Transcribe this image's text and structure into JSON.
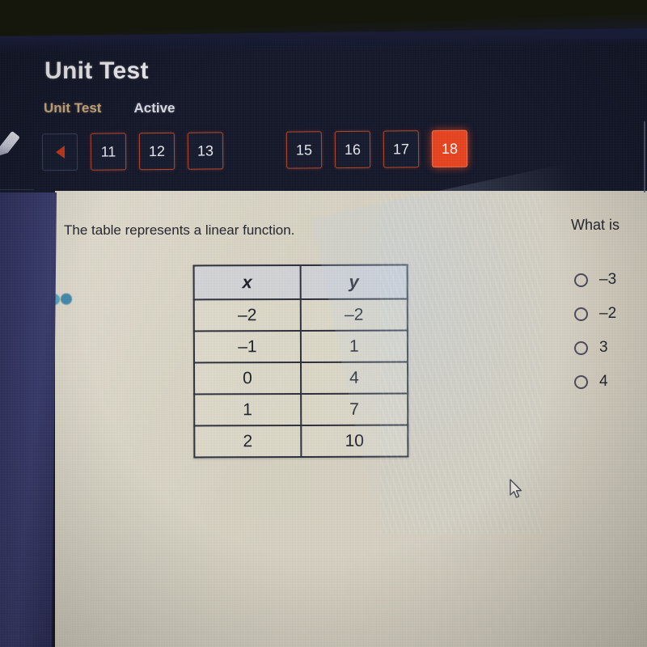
{
  "header": {
    "title": "Unit Test",
    "tab_unit_test": "Unit Test",
    "tab_active": "Active",
    "accent_color": "#cdab80"
  },
  "question_nav": {
    "prev_icon": "left-triangle-icon",
    "buttons": [
      "11",
      "12",
      "13",
      "15",
      "16",
      "17",
      "18"
    ],
    "current": "18",
    "outline_color": "#b8452a",
    "current_bg_color": "#e8431e"
  },
  "tools": {
    "highlighter": "highlighter-icon",
    "calculator": "calculator-icon",
    "arrow": "arrow-up-icon",
    "palette_colors": [
      "#4aa06a",
      "#3f7fb8",
      "#5a63b5",
      "#4b86c4",
      "#3fa0b8",
      "#2f7fa8"
    ]
  },
  "content": {
    "question_text": "The table represents a linear function.",
    "prompt": "What is"
  },
  "chart_data": {
    "type": "table",
    "title": "The table represents a linear function.",
    "columns": [
      "x",
      "y"
    ],
    "rows": [
      [
        "–2",
        "–2"
      ],
      [
        "–1",
        "1"
      ],
      [
        "0",
        "4"
      ],
      [
        "1",
        "7"
      ],
      [
        "2",
        "10"
      ]
    ],
    "x": [
      -2,
      -1,
      0,
      1,
      2
    ],
    "y": [
      -2,
      1,
      4,
      7,
      10
    ],
    "series": [
      {
        "name": "y",
        "values": [
          -2,
          1,
          4,
          7,
          10
        ]
      }
    ],
    "xlabel": "x",
    "ylabel": "y"
  },
  "answers": {
    "options": [
      {
        "label": "–3",
        "selected": false
      },
      {
        "label": "–2",
        "selected": false
      },
      {
        "label": "3",
        "selected": false
      },
      {
        "label": "4",
        "selected": false
      }
    ]
  },
  "cursor": {
    "icon": "mouse-pointer-icon"
  }
}
